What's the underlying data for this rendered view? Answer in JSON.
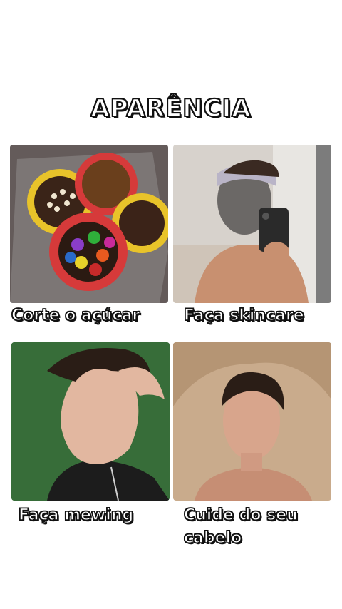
{
  "title": "APARÊNCIA",
  "tiles": [
    {
      "caption": "Corte o açúcar",
      "image": "brigadeiros-candy-photo"
    },
    {
      "caption": "Faça skincare",
      "image": "face-mask-selfie-photo"
    },
    {
      "caption": "Faça mewing",
      "image": "jawline-profile-photo"
    },
    {
      "caption_line1": "Cuide do seu",
      "caption_line2": "cabelo",
      "image": "hair-portrait-photo"
    }
  ]
}
